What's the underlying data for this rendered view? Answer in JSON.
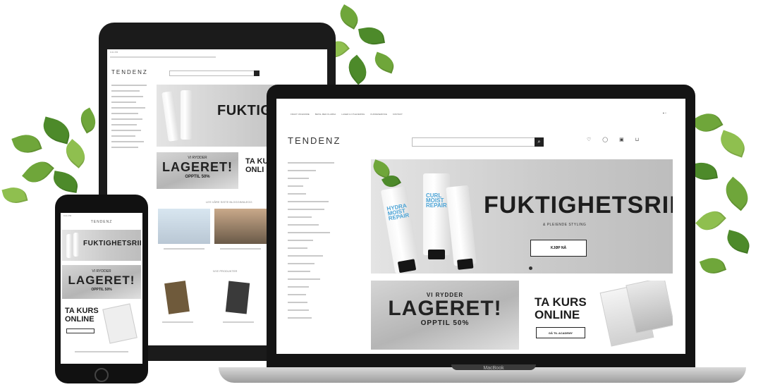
{
  "brand": {
    "logo": "TENDENZ",
    "device_label": "MacBook"
  },
  "laptop": {
    "top_nav": [
      "FRAKT OM ENDRE",
      "BETAL MED KLARNA",
      "LAGER & UTLEVERING",
      "KUNDESERVICE",
      "KONTAKT"
    ],
    "header_icons": [
      "heart-icon",
      "user-icon",
      "lock-icon",
      "cart-icon"
    ],
    "hero": {
      "title": "FUKTIGHETSRIK",
      "subtitle": "& PLEIENDE STYLING",
      "button": "KJØP NÅ",
      "tube_labels": [
        "HYDRA MOIST REPAIR",
        "CURL MOIST REPAIR"
      ]
    },
    "promo": {
      "top": "VI RYDDER",
      "big": "LAGERET!",
      "bottom": "OPPTIL 50%"
    },
    "course": {
      "title_line1": "TA KURS",
      "title_line2": "ONLINE",
      "button": "GÅ TIL ACADEMY"
    }
  },
  "tablet": {
    "status_time": "9:41 PM",
    "hero_title": "FUKTIGHE",
    "promo_big": "LAGERET!",
    "promo_small": "OPPTIL 50%",
    "promo_top": "VI RYDDER",
    "course_title_line1": "TA KURS",
    "course_title_line2": "ONLI",
    "section_title_1": "LES VÅRE SISTE BLOGGINNLEGG",
    "section_title_2": "NYE PRODUKTER"
  },
  "phone": {
    "status_time": "9:41 PM",
    "header": "TENDENZ",
    "hero_title": "FUKTIGHETSRIK",
    "promo_top": "VI RYDDER",
    "promo_big": "LAGERET!",
    "promo_small": "OPPTIL 50%",
    "course_title_line1": "TA KURS",
    "course_title_line2": "ONLINE"
  }
}
